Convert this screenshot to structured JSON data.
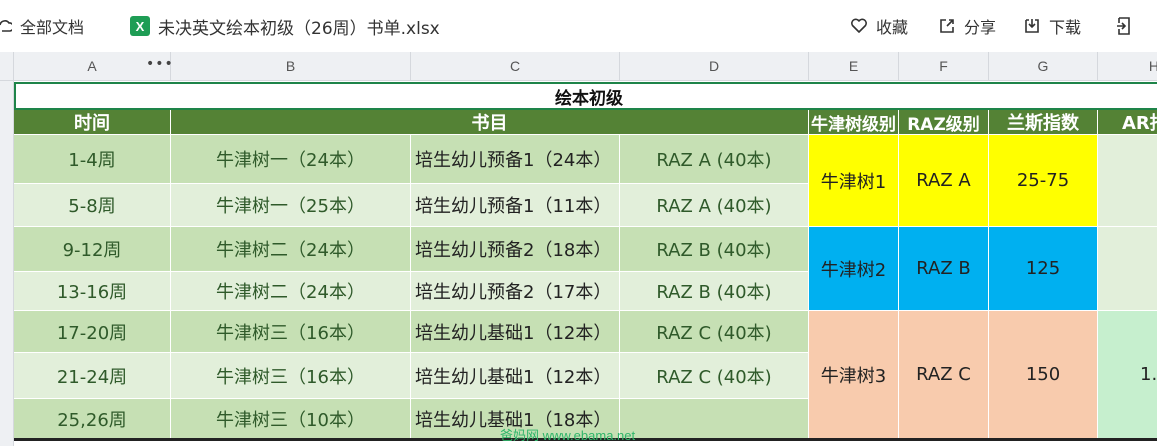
{
  "topbar": {
    "all_docs": "全部文档",
    "file_icon_letter": "X",
    "file_name": "未决英文绘本初级（26周）书单.xlsx",
    "favorite": "收藏",
    "share": "分享",
    "download": "下载"
  },
  "columns": [
    "A",
    "B",
    "C",
    "D",
    "E",
    "F",
    "G",
    "H"
  ],
  "colors": {
    "header_green": "#548235",
    "dark_green": "#c6e0b4",
    "light_green": "#e2efda",
    "yellow": "#ffff00",
    "blue": "#00b0f0",
    "peach": "#f8cbad",
    "mint": "#c6efce"
  },
  "sheet": {
    "title": "绘本初级",
    "headers": {
      "time": "时间",
      "books": "书目",
      "oxford": "牛津树级别",
      "raz": "RAZ级别",
      "lexile": "兰斯指数",
      "ar": "AR指"
    },
    "rows": [
      {
        "time": "1-4周",
        "b": "牛津树一（24本）",
        "c": "培生幼儿预备1（24本）",
        "d": "RAZ A (40本)"
      },
      {
        "time": "5-8周",
        "b": "牛津树一（25本）",
        "c": "培生幼儿预备1（11本）",
        "d": "RAZ A (40本)"
      },
      {
        "time": "9-12周",
        "b": "牛津树二（24本）",
        "c": "培生幼儿预备2（18本）",
        "d": "RAZ B (40本)"
      },
      {
        "time": "13-16周",
        "b": "牛津树二（24本）",
        "c": "培生幼儿预备2（17本）",
        "d": "RAZ B (40本)"
      },
      {
        "time": "17-20周",
        "b": "牛津树三（16本）",
        "c": "培生幼儿基础1（12本）",
        "d": "RAZ C (40本)"
      },
      {
        "time": "21-24周",
        "b": "牛津树三（16本）",
        "c": "培生幼儿基础1（12本）",
        "d": "RAZ C (40本)"
      },
      {
        "time": "25,26周",
        "b": "牛津树三（10本）",
        "c": "培生幼儿基础1（18本）",
        "d": ""
      }
    ],
    "groups": [
      {
        "oxford": "牛津树1",
        "raz": "RAZ A",
        "lexile": "25-75",
        "ar": ""
      },
      {
        "oxford": "牛津树2",
        "raz": "RAZ B",
        "lexile": "125",
        "ar": ""
      },
      {
        "oxford": "牛津树3",
        "raz": "RAZ C",
        "lexile": "150",
        "ar": "1."
      }
    ]
  },
  "watermark": "爸妈网 www.ebama.net"
}
